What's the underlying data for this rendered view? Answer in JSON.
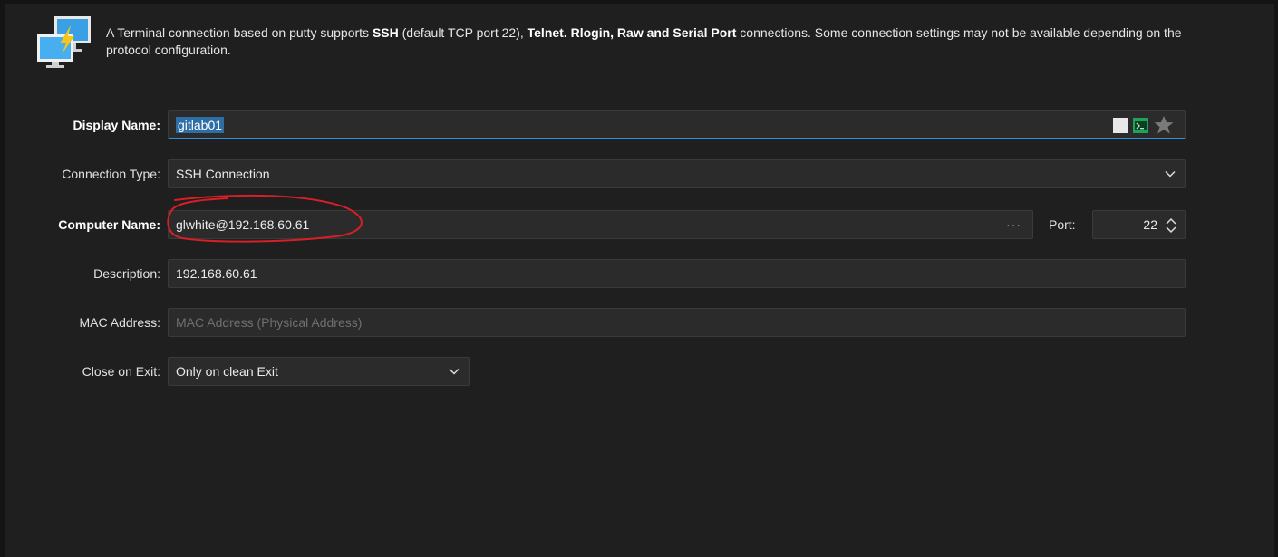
{
  "header": {
    "description_parts": [
      {
        "text": "A Terminal connection based on putty supports ",
        "bold": false
      },
      {
        "text": "SSH",
        "bold": true
      },
      {
        "text": " (default TCP port 22), ",
        "bold": false
      },
      {
        "text": "Telnet. Rlogin, Raw and Serial Port",
        "bold": true
      },
      {
        "text": " connections. Some connection settings may not be available depending on the protocol configuration.",
        "bold": false
      }
    ],
    "icon": "terminal-computers-icon"
  },
  "form": {
    "display_name": {
      "label": "Display Name:",
      "value": "gitlab01"
    },
    "connection_type": {
      "label": "Connection Type:",
      "value": "SSH Connection"
    },
    "computer_name": {
      "label": "Computer Name:",
      "value": "glwhite@192.168.60.61",
      "browse": "···"
    },
    "port": {
      "label": "Port:",
      "value": "22"
    },
    "description": {
      "label": "Description:",
      "value": "192.168.60.61"
    },
    "mac_address": {
      "label": "MAC Address:",
      "value": "",
      "placeholder": "MAC Address (Physical Address)"
    },
    "close_on_exit": {
      "label": "Close on Exit:",
      "value": "Only on clean Exit"
    }
  },
  "colors": {
    "background": "#1f1f1f",
    "field_bg": "#2b2b2b",
    "focus_accent": "#2f8fd8",
    "annotation": "#d61f26",
    "terminal_icon": "#1fa35a",
    "star": "#7a7a7a"
  }
}
